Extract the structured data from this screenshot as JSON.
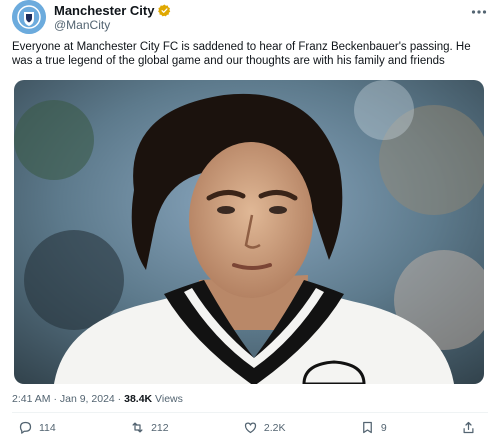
{
  "account": {
    "name": "Manchester City",
    "handle": "@ManCity",
    "verified_color": "#e0a800"
  },
  "tweet": {
    "text": "Everyone at Manchester City FC is saddened to hear of Franz Beckenbauer's passing. He was a true legend of the global game and our thoughts are with his family and friends",
    "time": "2:41 AM",
    "separator": " · ",
    "date": "Jan 9, 2024",
    "views_count": "38.4K",
    "views_label": " Views"
  },
  "actions": {
    "replies": "114",
    "reposts": "212",
    "likes": "2.2K",
    "bookmarks": "9"
  },
  "icons": {
    "more": "more-icon",
    "reply": "reply-icon",
    "repost": "repost-icon",
    "like": "like-icon",
    "bookmark": "bookmark-icon",
    "share": "share-icon"
  },
  "colors": {
    "text": "#0f1419",
    "secondary": "#536471",
    "brand": "#6cabdd"
  }
}
